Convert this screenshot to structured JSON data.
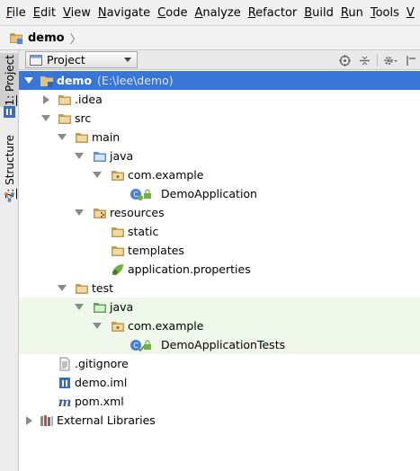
{
  "menu": {
    "items": [
      "File",
      "Edit",
      "View",
      "Navigate",
      "Code",
      "Analyze",
      "Refactor",
      "Build",
      "Run",
      "Tools",
      "V"
    ]
  },
  "navbar": {
    "crumb": "demo"
  },
  "left_tabs": {
    "project": "1: Project",
    "structure": "7: Structure"
  },
  "toolwindow": {
    "view_selector": "Project",
    "header_icons": [
      "sync-icon",
      "collapse-all-icon",
      "settings-icon",
      "hide-icon"
    ]
  },
  "tree": {
    "root_name": "demo",
    "root_path": "(E:\\lee\\demo)",
    "nodes": {
      "idea": ".idea",
      "src": "src",
      "main": "main",
      "main_java": "java",
      "main_pkg": "com.example",
      "main_class": "DemoApplication",
      "resources": "resources",
      "static": "static",
      "templates": "templates",
      "app_props": "application.properties",
      "test": "test",
      "test_java": "java",
      "test_pkg": "com.example",
      "test_class": "DemoApplicationTests",
      "gitignore": ".gitignore",
      "iml": "demo.iml",
      "pom": "pom.xml",
      "ext_libs": "External Libraries"
    }
  },
  "colors": {
    "selection": "#3875d7",
    "test_highlight": "#eff7ea",
    "folder": "#c39a4e",
    "source_folder": "#5a8fd6",
    "test_folder": "#63a35c"
  }
}
